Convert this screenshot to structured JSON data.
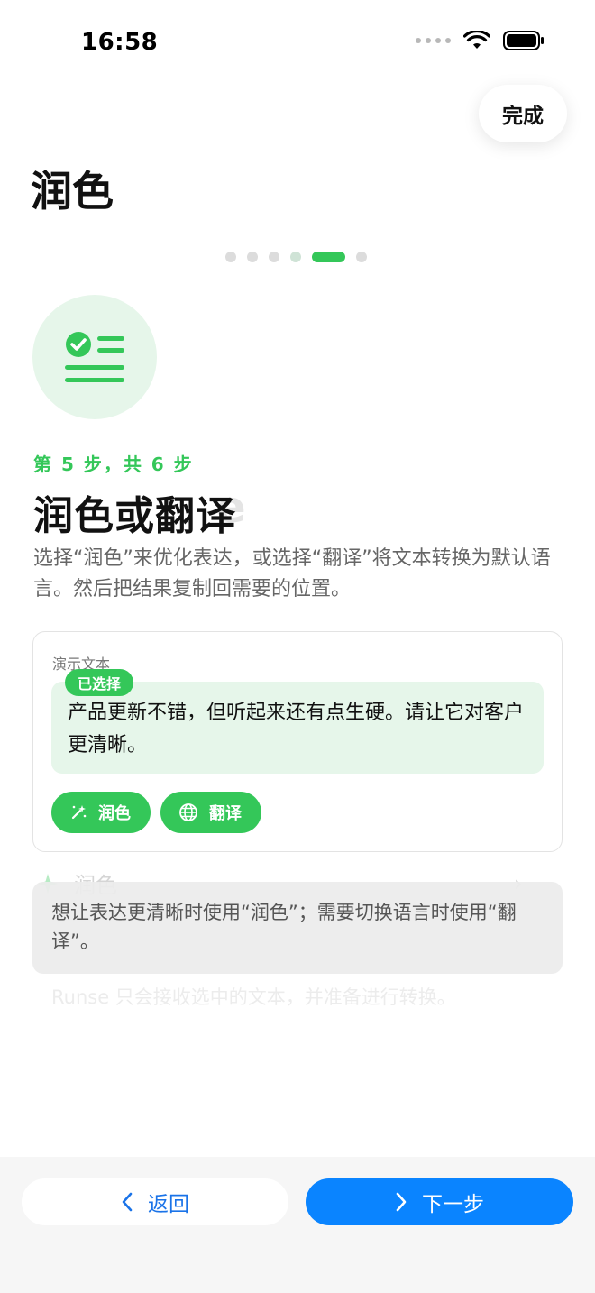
{
  "status_bar": {
    "time": "16:58"
  },
  "header": {
    "done_label": "完成",
    "title": "润色"
  },
  "pager": {
    "total": 6,
    "current": 5
  },
  "step": {
    "label": "第 5 步，共 6 步",
    "heading": "润色或翻译",
    "description": "选择“润色”来优化表达，或选择“翻译”将文本转换为默认语言。然后把结果复制回需要的位置。"
  },
  "demo_card": {
    "label": "演示文本",
    "selected_badge": "已选择",
    "text": "产品更新不错，但听起来还有点生硬。请让它对客户更清晰。",
    "buttons": {
      "polish": "润色",
      "translate": "翻译"
    }
  },
  "background_layer": {
    "row_label": "润色",
    "footer_text": "Runse 只会接收选中的文本，并准备进行转换。"
  },
  "tip": {
    "text": "想让表达更清晰时使用“润色”；需要切换语言时使用“翻译”。"
  },
  "footer": {
    "back_label": "返回",
    "next_label": "下一步"
  },
  "colors": {
    "accent_green": "#34c759",
    "light_green": "#e6f6ea",
    "primary_blue": "#0a84ff",
    "link_blue": "#1a73e8"
  }
}
